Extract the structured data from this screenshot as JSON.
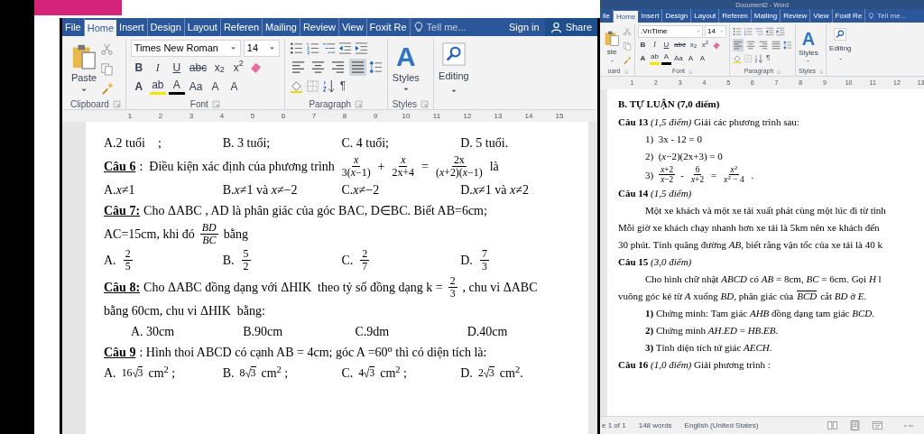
{
  "left_window": {
    "tabs": [
      {
        "label": "File",
        "selected": false
      },
      {
        "label": "Home",
        "selected": true
      },
      {
        "label": "Insert",
        "selected": false
      },
      {
        "label": "Design",
        "selected": false
      },
      {
        "label": "Layout",
        "selected": false
      },
      {
        "label": "Referen",
        "selected": false
      },
      {
        "label": "Mailing",
        "selected": false
      },
      {
        "label": "Review",
        "selected": false
      },
      {
        "label": "View",
        "selected": false
      },
      {
        "label": "Foxit Re",
        "selected": false
      }
    ],
    "tell_me": "Tell me...",
    "sign_in": "Sign in",
    "share": "Share",
    "ribbon": {
      "paste": "Paste",
      "font_name": "Times New Roman",
      "font_size": "14",
      "format_buttons": [
        "B",
        "I",
        "U",
        "abc",
        "x$_{2}$",
        "x$^{2}$"
      ],
      "effect_buttons": [
        "A",
        "ab",
        "A",
        "Aa",
        "A",
        "A"
      ],
      "alignment_buttons": [
        {
          "selected": false
        },
        {
          "selected": false
        },
        {
          "selected": false
        },
        {
          "selected": true
        }
      ],
      "pilcrow": "¶",
      "styles_glyph": "A",
      "styles": "Styles",
      "editing": "Editing",
      "groups": [
        "Clipboard",
        "Font",
        "Paragraph",
        "Styles"
      ]
    },
    "ruler": [
      "1",
      "2",
      "3",
      "4",
      "5",
      "6",
      "7",
      "8",
      "9",
      "10",
      "11",
      "12",
      "13",
      "14",
      "15"
    ],
    "document": [
      {
        "kind": "options",
        "items": [
          [
            {
              "kind": "text",
              "text": "A.2 tuổi    ;"
            }
          ],
          [
            {
              "kind": "text",
              "text": "B. 3 tuổi;"
            }
          ],
          [
            {
              "kind": "text",
              "text": "C. 4 tuổi;"
            }
          ],
          [
            {
              "kind": "text",
              "text": "D. 5 tuổi."
            }
          ]
        ]
      },
      {
        "kind": "para",
        "parts": [
          {
            "kind": "label",
            "text": "Câu 6"
          },
          {
            "kind": "text",
            "text": ":  Điều kiện xác định của phương trình"
          },
          {
            "kind": "frac",
            "num": "*x*",
            "den": "3(*x*−1)"
          },
          {
            "kind": "text",
            "text": "+"
          },
          {
            "kind": "frac",
            "num": "*x*",
            "den": "2x+4"
          },
          {
            "kind": "text",
            "text": "="
          },
          {
            "kind": "frac",
            "num": "2x",
            "den": "(*x*+2)(*x*−1)"
          },
          {
            "kind": "text",
            "text": "là"
          }
        ]
      },
      {
        "kind": "options",
        "items": [
          [
            {
              "kind": "text",
              "text": "A.*x*≠1"
            }
          ],
          [
            {
              "kind": "text",
              "text": "B.*x*≠1 và *x*≠−2"
            }
          ],
          [
            {
              "kind": "text",
              "text": "C.*x*≠−2"
            }
          ],
          [
            {
              "kind": "text",
              "text": "D.*x*≠1 và *x*≠2"
            }
          ]
        ]
      },
      {
        "kind": "para",
        "parts": [
          {
            "kind": "label",
            "text": "Câu 7:"
          },
          {
            "kind": "text",
            "text": "Cho ΔABC , AD là phân giác của góc BAC, D∈BC. Biết AB=6cm;"
          }
        ]
      },
      {
        "kind": "para",
        "parts": [
          {
            "kind": "text",
            "text": "AC=15cm, khi đó"
          },
          {
            "kind": "frac",
            "num": "*BD*",
            "den": "*BC*"
          },
          {
            "kind": "text",
            "text": "bằng"
          }
        ]
      },
      {
        "kind": "options",
        "items": [
          [
            {
              "kind": "text",
              "text": "A."
            },
            {
              "kind": "frac",
              "num": "2",
              "den": "5"
            }
          ],
          [
            {
              "kind": "text",
              "text": "B."
            },
            {
              "kind": "frac",
              "num": "5",
              "den": "2"
            }
          ],
          [
            {
              "kind": "text",
              "text": "C."
            },
            {
              "kind": "frac",
              "num": "2",
              "den": "7"
            }
          ],
          [
            {
              "kind": "text",
              "text": "D."
            },
            {
              "kind": "frac",
              "num": "7",
              "den": "3"
            }
          ]
        ]
      },
      {
        "kind": "para",
        "parts": [
          {
            "kind": "label",
            "text": "Câu 8:"
          },
          {
            "kind": "text",
            "text": "Cho ΔABC đồng dạng với ΔHIK  theo tỷ số đồng dạng k ="
          },
          {
            "kind": "frac",
            "num": "2",
            "den": "3"
          },
          {
            "kind": "text",
            "text": ", chu vi ΔABC"
          }
        ]
      },
      {
        "kind": "para",
        "parts": [
          {
            "kind": "text",
            "text": "bằng 60cm, chu vi ΔHIK  bằng:"
          }
        ]
      },
      {
        "kind": "options",
        "indented": true,
        "items": [
          [
            {
              "kind": "text",
              "text": "A. 30cm"
            }
          ],
          [
            {
              "kind": "text",
              "text": "B.90cm"
            }
          ],
          [
            {
              "kind": "text",
              "text": "C.9dm"
            }
          ],
          [
            {
              "kind": "text",
              "text": "D.40cm"
            }
          ]
        ]
      },
      {
        "kind": "para",
        "parts": [
          {
            "kind": "label",
            "text": "Câu 9"
          },
          {
            "kind": "text",
            "text": ": Hình thoi ABCD có cạnh AB = 4cm; góc A =60$^{o}$ thì có diện tích là:"
          }
        ]
      },
      {
        "kind": "options",
        "items": [
          [
            {
              "kind": "text",
              "text": "A."
            },
            {
              "kind": "sqrt",
              "coef": "16",
              "radicand": "3"
            },
            {
              "kind": "text",
              "text": "cm$^{2}$ ;"
            }
          ],
          [
            {
              "kind": "text",
              "text": "B."
            },
            {
              "kind": "sqrt",
              "coef": "8",
              "radicand": "3"
            },
            {
              "kind": "text",
              "text": "cm$^{2}$ ;"
            }
          ],
          [
            {
              "kind": "text",
              "text": "C."
            },
            {
              "kind": "sqrt",
              "coef": "4",
              "radicand": "3"
            },
            {
              "kind": "text",
              "text": "cm$^{2}$ ;"
            }
          ],
          [
            {
              "kind": "text",
              "text": "D."
            },
            {
              "kind": "sqrt",
              "coef": "2",
              "radicand": "3"
            },
            {
              "kind": "text",
              "text": "cm$^{2}$."
            }
          ]
        ]
      }
    ]
  },
  "right_window": {
    "title": "Document2 - Word",
    "tabs": [
      {
        "label": "ile",
        "selected": false
      },
      {
        "label": "Home",
        "selected": true
      },
      {
        "label": "Insert",
        "selected": false
      },
      {
        "label": "Design",
        "selected": false
      },
      {
        "label": "Layout",
        "selected": false
      },
      {
        "label": "Referen",
        "selected": false
      },
      {
        "label": "Mailing",
        "selected": false
      },
      {
        "label": "Review",
        "selected": false
      },
      {
        "label": "View",
        "selected": false
      },
      {
        "label": "Foxit Re",
        "selected": false
      }
    ],
    "tell_me": "Tell me...",
    "ribbon": {
      "paste": "ste",
      "font_name": ".VnTime",
      "font_size": "14",
      "format_buttons": [
        "B",
        "I",
        "U",
        "abc",
        "x$_{2}$",
        "x$^{2}$"
      ],
      "effect_buttons": [
        "A",
        "ab",
        "A",
        "Aa",
        "A",
        "A"
      ],
      "alignment_buttons": [
        {
          "selected": true
        },
        {
          "selected": false
        },
        {
          "selected": false
        },
        {
          "selected": false
        }
      ],
      "pilcrow": "¶",
      "styles_glyph": "A",
      "styles": "Styles",
      "editing": "Editing",
      "groups": [
        "oard",
        "Font",
        "Paragraph",
        "Styles"
      ]
    },
    "ruler": [
      "1",
      "2",
      "3",
      "4",
      "5",
      "6",
      "7",
      "8",
      "9",
      "10",
      "11",
      "12",
      "13"
    ],
    "document": [
      {
        "kind": "heading",
        "text": "B. TỰ LUẬN (7,0 điểm)"
      },
      {
        "kind": "para",
        "parts": [
          {
            "kind": "text",
            "text": "**Câu 13** *(1,5 điểm)* Giải các phương trình sau:"
          }
        ]
      },
      {
        "kind": "para",
        "indented": true,
        "parts": [
          {
            "kind": "text",
            "text": "1)  3x - 12 = 0"
          }
        ]
      },
      {
        "kind": "para",
        "indented": true,
        "parts": [
          {
            "kind": "text",
            "text": "2)  (*x*−2)(2x+3) = 0"
          }
        ]
      },
      {
        "kind": "para",
        "indented": true,
        "parts": [
          {
            "kind": "text",
            "text": "3)"
          },
          {
            "kind": "frac",
            "num": "*x*+2",
            "den": "*x*−2"
          },
          {
            "kind": "text",
            "text": "-"
          },
          {
            "kind": "frac",
            "num": "6",
            "den": "*x*+2"
          },
          {
            "kind": "text",
            "text": "="
          },
          {
            "kind": "frac",
            "num": "*x*$^{2}$",
            "den": "*x*$^{2}$ − 4"
          },
          {
            "kind": "text",
            "text": "."
          }
        ]
      },
      {
        "kind": "para",
        "parts": [
          {
            "kind": "text",
            "text": "**Câu 14** *(1,5 điểm)*"
          }
        ]
      },
      {
        "kind": "para",
        "indented": true,
        "parts": [
          {
            "kind": "text",
            "text": "Một xe khách và một xe tải xuất phát cùng một lúc đi từ tỉnh"
          }
        ]
      },
      {
        "kind": "para",
        "parts": [
          {
            "kind": "text",
            "text": "Mỗi giờ xe khách chạy nhanh hơn xe tải là 5km nên xe khách đến"
          }
        ]
      },
      {
        "kind": "para",
        "parts": [
          {
            "kind": "text",
            "text": "30 phút. Tính quãng đường *AB*, biết rằng vận tốc của xe tải là 40 k"
          }
        ]
      },
      {
        "kind": "para",
        "parts": [
          {
            "kind": "text",
            "text": "**Câu 15** *(3,0 điểm)*"
          }
        ]
      },
      {
        "kind": "para",
        "indented": true,
        "parts": [
          {
            "kind": "text",
            "text": "Cho hình chữ nhật *ABCD* có *AB* = 8cm, *BC* = 6cm. Gọi *H* l"
          }
        ]
      },
      {
        "kind": "para",
        "parts": [
          {
            "kind": "text",
            "text": "vuông góc kẻ từ *A* xuống *BD*, phân giác của"
          },
          {
            "kind": "overline",
            "text": "*BCD*"
          },
          {
            "kind": "text",
            "text": "cắt *BD* ở *E*."
          }
        ]
      },
      {
        "kind": "para",
        "indented": true,
        "parts": [
          {
            "kind": "text",
            "text": "**1)** Chứng minh: Tam giác *AHB* đồng dạng tam giác *BCD*."
          }
        ]
      },
      {
        "kind": "para",
        "indented": true,
        "parts": [
          {
            "kind": "text",
            "text": "**2)** Chứng minh *AH*.*ED* = *HB*.*EB*."
          }
        ]
      },
      {
        "kind": "para",
        "indented": true,
        "parts": [
          {
            "kind": "text",
            "text": "**3)** Tính diện tích tứ giác *AECH*."
          }
        ]
      },
      {
        "kind": "para",
        "parts": [
          {
            "kind": "text",
            "text": "**Câu 16** *(1,0 điểm)* Giải phương trình :"
          }
        ]
      }
    ],
    "status_bar": {
      "page": "e 1 of 1",
      "words": "148 words",
      "language": "English (United States)"
    }
  }
}
